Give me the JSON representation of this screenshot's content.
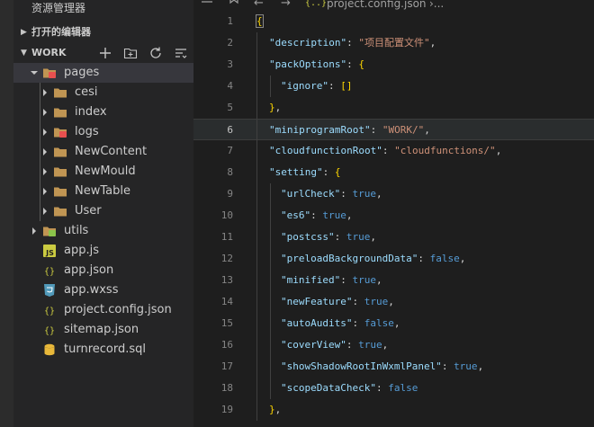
{
  "sidebar": {
    "title": "资源管理器",
    "open_editors": "打开的编辑器",
    "workspace": "WORK",
    "actions": [
      "new-file",
      "new-folder",
      "refresh",
      "collapse-all"
    ],
    "tree": [
      {
        "label": "pages",
        "type": "folder-special",
        "expanded": true,
        "selected": true
      },
      {
        "label": "cesi",
        "type": "folder"
      },
      {
        "label": "index",
        "type": "folder"
      },
      {
        "label": "logs",
        "type": "folder-special"
      },
      {
        "label": "NewContent",
        "type": "folder"
      },
      {
        "label": "NewMould",
        "type": "folder"
      },
      {
        "label": "NewTable",
        "type": "folder"
      },
      {
        "label": "User",
        "type": "folder"
      },
      {
        "label": "utils",
        "type": "folder-special-green"
      },
      {
        "label": "app.js",
        "type": "js"
      },
      {
        "label": "app.json",
        "type": "json"
      },
      {
        "label": "app.wxss",
        "type": "css"
      },
      {
        "label": "project.config.json",
        "type": "json"
      },
      {
        "label": "sitemap.json",
        "type": "json"
      },
      {
        "label": "turnrecord.sql",
        "type": "database"
      }
    ]
  },
  "editor": {
    "breadcrumb_icon": "{..}",
    "breadcrumb_file": "project.config.json",
    "breadcrumb_more": "›..."
  },
  "code_lines": [
    {
      "n": "1",
      "text": "{"
    },
    {
      "n": "2",
      "text": "\"description\": \"项目配置文件\","
    },
    {
      "n": "3",
      "text": "\"packOptions\": {"
    },
    {
      "n": "4",
      "text": "\"ignore\": []"
    },
    {
      "n": "5",
      "text": "},"
    },
    {
      "n": "6",
      "text": "\"miniprogramRoot\": \"WORK/\","
    },
    {
      "n": "7",
      "text": "\"cloudfunctionRoot\": \"cloudfunctions/\","
    },
    {
      "n": "8",
      "text": "\"setting\": {"
    },
    {
      "n": "9",
      "text": "\"urlCheck\": true,"
    },
    {
      "n": "10",
      "text": "\"es6\": true,"
    },
    {
      "n": "11",
      "text": "\"postcss\": true,"
    },
    {
      "n": "12",
      "text": "\"preloadBackgroundData\": false,"
    },
    {
      "n": "13",
      "text": "\"minified\": true,"
    },
    {
      "n": "14",
      "text": "\"newFeature\": true,"
    },
    {
      "n": "15",
      "text": "\"autoAudits\": false,"
    },
    {
      "n": "16",
      "text": "\"coverView\": true,"
    },
    {
      "n": "17",
      "text": "\"showShadowRootInWxmlPanel\": true,"
    },
    {
      "n": "18",
      "text": "\"scopeDataCheck\": false"
    },
    {
      "n": "19",
      "text": "},"
    }
  ],
  "colors": {
    "key": "#9cdcfe",
    "string": "#ce9178",
    "boolean": "#569cd6",
    "bracket": "#ffd700",
    "folder": "#c09553",
    "js": "#cbcb41",
    "css": "#519aba"
  }
}
